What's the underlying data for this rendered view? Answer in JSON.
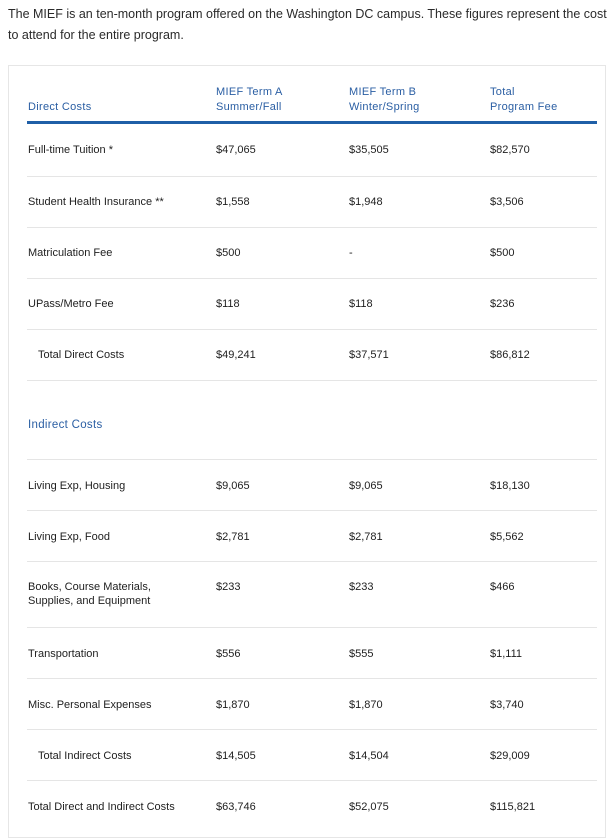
{
  "intro": "The MIEF is an ten-month program offered on the Washington DC campus. These figures represent the cost to attend for the entire program.",
  "header": {
    "col0": "Direct Costs",
    "col1": "MIEF Term A\nSummer/Fall",
    "col2": "MIEF Term B\nWinter/Spring",
    "col3": "Total\nProgram Fee"
  },
  "direct_rows": [
    {
      "label": "Full-time Tuition *",
      "a": "$47,065",
      "b": "$35,505",
      "total": "$82,570"
    },
    {
      "label": "Student Health Insurance **",
      "a": "$1,558",
      "b": "$1,948",
      "total": "$3,506"
    },
    {
      "label": "Matriculation Fee",
      "a": "$500",
      "b": "-",
      "total": "$500"
    },
    {
      "label": "UPass/Metro Fee",
      "a": "$118",
      "b": "$118",
      "total": "$236"
    },
    {
      "label": "Total Direct Costs",
      "a": "$49,241",
      "b": "$37,571",
      "total": "$86,812"
    }
  ],
  "indirect_section": "Indirect Costs",
  "indirect_rows": [
    {
      "label": "Living Exp, Housing",
      "a": "$9,065",
      "b": "$9,065",
      "total": "$18,130"
    },
    {
      "label": "Living Exp, Food",
      "a": "$2,781",
      "b": "$2,781",
      "total": "$5,562"
    },
    {
      "label": "Books, Course Materials, Supplies, and Equipment",
      "a": "$233",
      "b": "$233",
      "total": "$466"
    },
    {
      "label": "Transportation",
      "a": "$556",
      "b": "$555",
      "total": "$1,111"
    },
    {
      "label": "Misc. Personal Expenses",
      "a": "$1,870",
      "b": "$1,870",
      "total": "$3,740"
    },
    {
      "label": "Total Indirect Costs",
      "a": "$14,505",
      "b": "$14,504",
      "total": "$29,009"
    },
    {
      "label": "Total Direct and Indirect Costs",
      "a": "$63,746",
      "b": "$52,075",
      "total": "$115,821"
    }
  ]
}
